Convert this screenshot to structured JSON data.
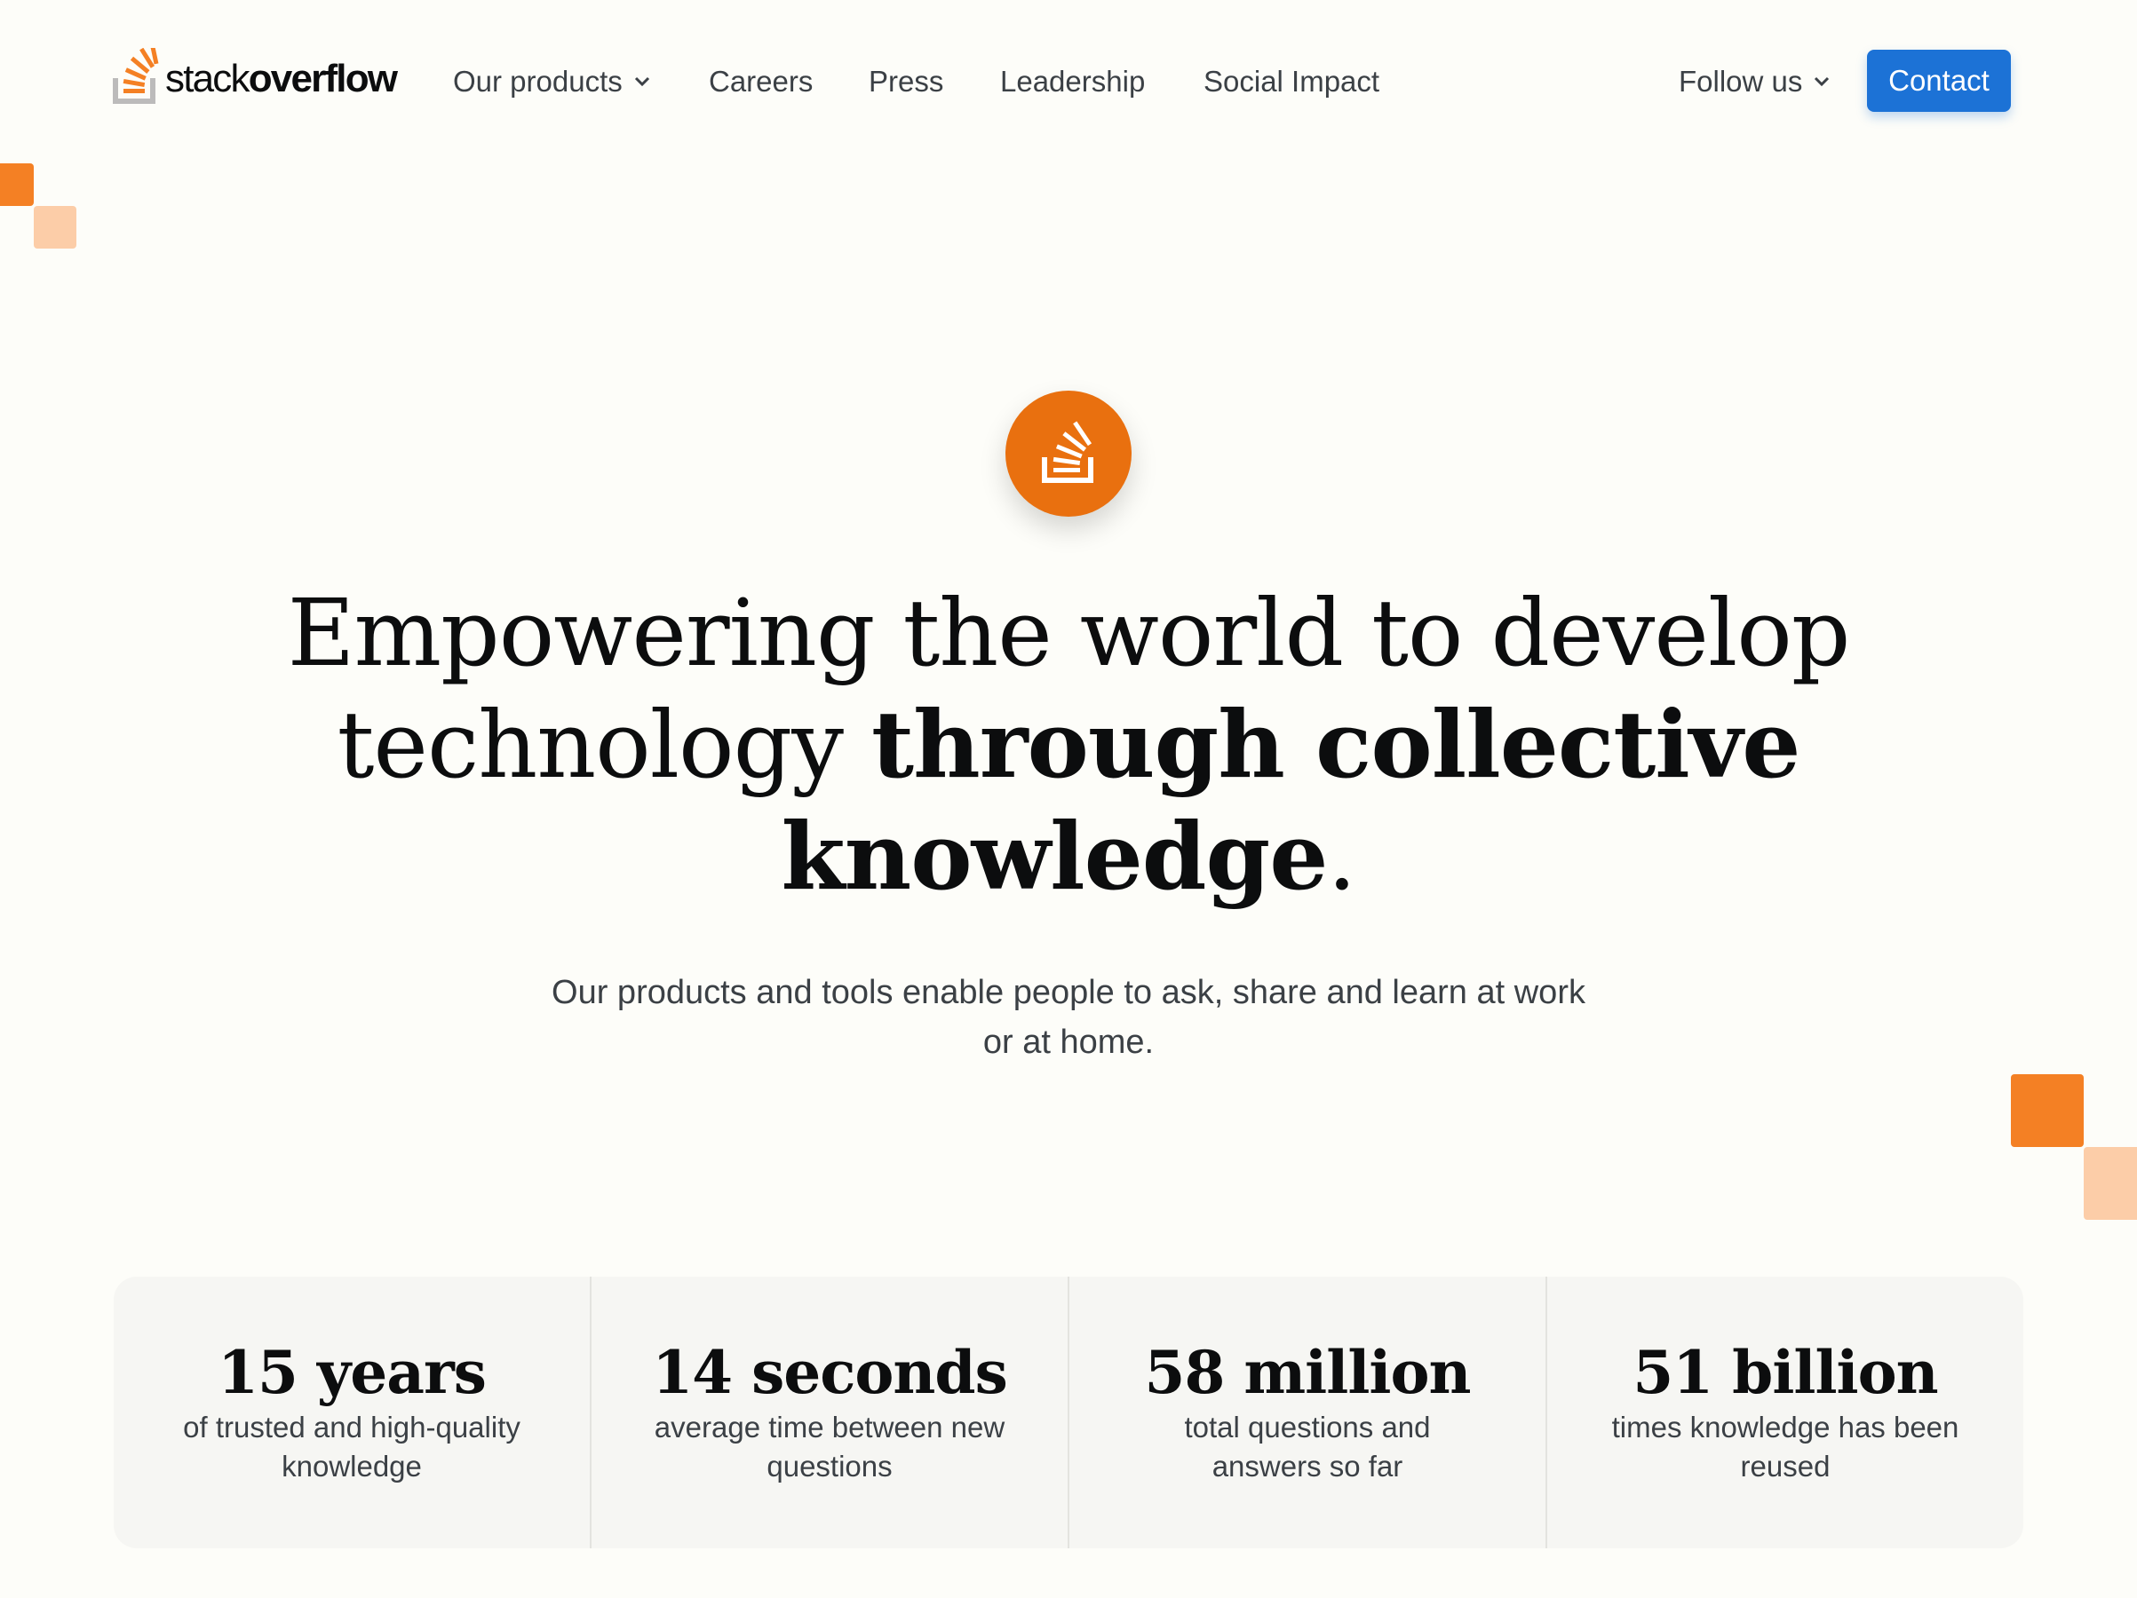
{
  "brand": {
    "logo_text_light": "stack",
    "logo_text_bold": "overflow",
    "accent_color": "#f48024",
    "badge_color": "#e9700f",
    "button_color": "#1c72d6"
  },
  "nav": {
    "our_products": "Our products",
    "careers": "Careers",
    "press": "Press",
    "leadership": "Leadership",
    "social_impact": "Social Impact",
    "follow_us": "Follow us",
    "contact": "Contact"
  },
  "hero": {
    "headline_regular_1": "Empowering the world to develop technology ",
    "headline_bold": "through collective knowledge",
    "headline_end": ".",
    "subheading": "Our products and tools enable people to ask, share and learn at work or at home."
  },
  "stats": [
    {
      "value": "15 years",
      "description": "of trusted and high-quality knowledge"
    },
    {
      "value": "14 seconds",
      "description": "average time between new questions"
    },
    {
      "value": "58 million",
      "description": "total questions and answers so far"
    },
    {
      "value": "51 billion",
      "description": "times knowledge has been reused"
    }
  ]
}
